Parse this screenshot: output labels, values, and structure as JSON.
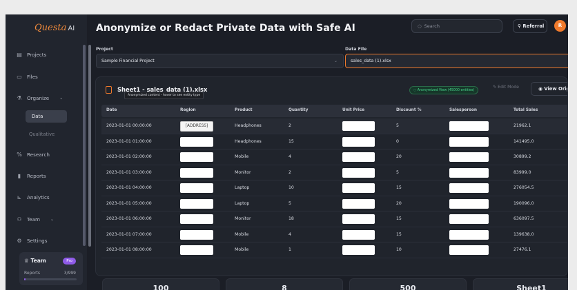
{
  "app": {
    "logo_text": "Questa",
    "logo_suffix": "AI",
    "page_title": "Anonymize or Redact Private Data with Safe AI"
  },
  "header": {
    "search_placeholder": "Search",
    "referral_label": "Referral",
    "avatar_initial": "R"
  },
  "sidebar": {
    "items": [
      {
        "label": "Projects",
        "icon": "folder-icon"
      },
      {
        "label": "Files",
        "icon": "file-icon"
      },
      {
        "label": "Organize",
        "icon": "organize-icon"
      },
      {
        "label": "Research",
        "icon": "research-icon"
      },
      {
        "label": "Reports",
        "icon": "report-icon"
      },
      {
        "label": "Analytics",
        "icon": "chart-icon"
      },
      {
        "label": "Team",
        "icon": "team-icon"
      },
      {
        "label": "Settings",
        "icon": "gear-icon"
      }
    ],
    "sub_items": [
      "Data",
      "Qualitative"
    ],
    "team_card": {
      "title": "Team",
      "badge": "Pro",
      "reports_label": "Reports",
      "reports_count": "3/999",
      "usage_fraction": 0.003
    }
  },
  "form": {
    "project_label": "Project",
    "project_value": "Sample Financial Project",
    "data_file_label": "Data File",
    "data_file_value": "sales_data (1).xlsx"
  },
  "sheet": {
    "title": "Sheet1 - sales_data (1).xlsx",
    "anonymized_badge": "Anonymized View (45000 entities)",
    "edit_mode_label": "Edit Mode",
    "view_original_label": "View Orig",
    "tooltip": "Anonymized content - hover to see entity type"
  },
  "table": {
    "columns": [
      "Date",
      "Region",
      "Product",
      "Quantity",
      "Unit Price",
      "Discount %",
      "Salesperson",
      "Total Sales"
    ],
    "rows": [
      {
        "date": "2023-01-01 00:00:00",
        "region": "[ADDRESS]",
        "product": "Headphones",
        "quantity": "2",
        "discount": "5",
        "total": "21962.1"
      },
      {
        "date": "2023-01-01 01:00:00",
        "region": "",
        "product": "Headphones",
        "quantity": "15",
        "discount": "0",
        "total": "141495.0"
      },
      {
        "date": "2023-01-01 02:00:00",
        "region": "",
        "product": "Mobile",
        "quantity": "4",
        "discount": "20",
        "total": "30899.2"
      },
      {
        "date": "2023-01-01 03:00:00",
        "region": "",
        "product": "Monitor",
        "quantity": "2",
        "discount": "5",
        "total": "83999.0"
      },
      {
        "date": "2023-01-01 04:00:00",
        "region": "",
        "product": "Laptop",
        "quantity": "10",
        "discount": "15",
        "total": "276054.5"
      },
      {
        "date": "2023-01-01 05:00:00",
        "region": "",
        "product": "Laptop",
        "quantity": "5",
        "discount": "20",
        "total": "190096.0"
      },
      {
        "date": "2023-01-01 06:00:00",
        "region": "",
        "product": "Monitor",
        "quantity": "18",
        "discount": "15",
        "total": "636097.5"
      },
      {
        "date": "2023-01-01 07:00:00",
        "region": "",
        "product": "Mobile",
        "quantity": "4",
        "discount": "15",
        "total": "139638.0"
      },
      {
        "date": "2023-01-01 08:00:00",
        "region": "",
        "product": "Mobile",
        "quantity": "1",
        "discount": "10",
        "total": "27476.1"
      }
    ]
  },
  "stats": [
    "100",
    "8",
    "500",
    "Sheet1"
  ],
  "colors": {
    "accent": "#f07a2c",
    "badge_green": "#47d38a",
    "pro_purple": "#8f5be8"
  }
}
